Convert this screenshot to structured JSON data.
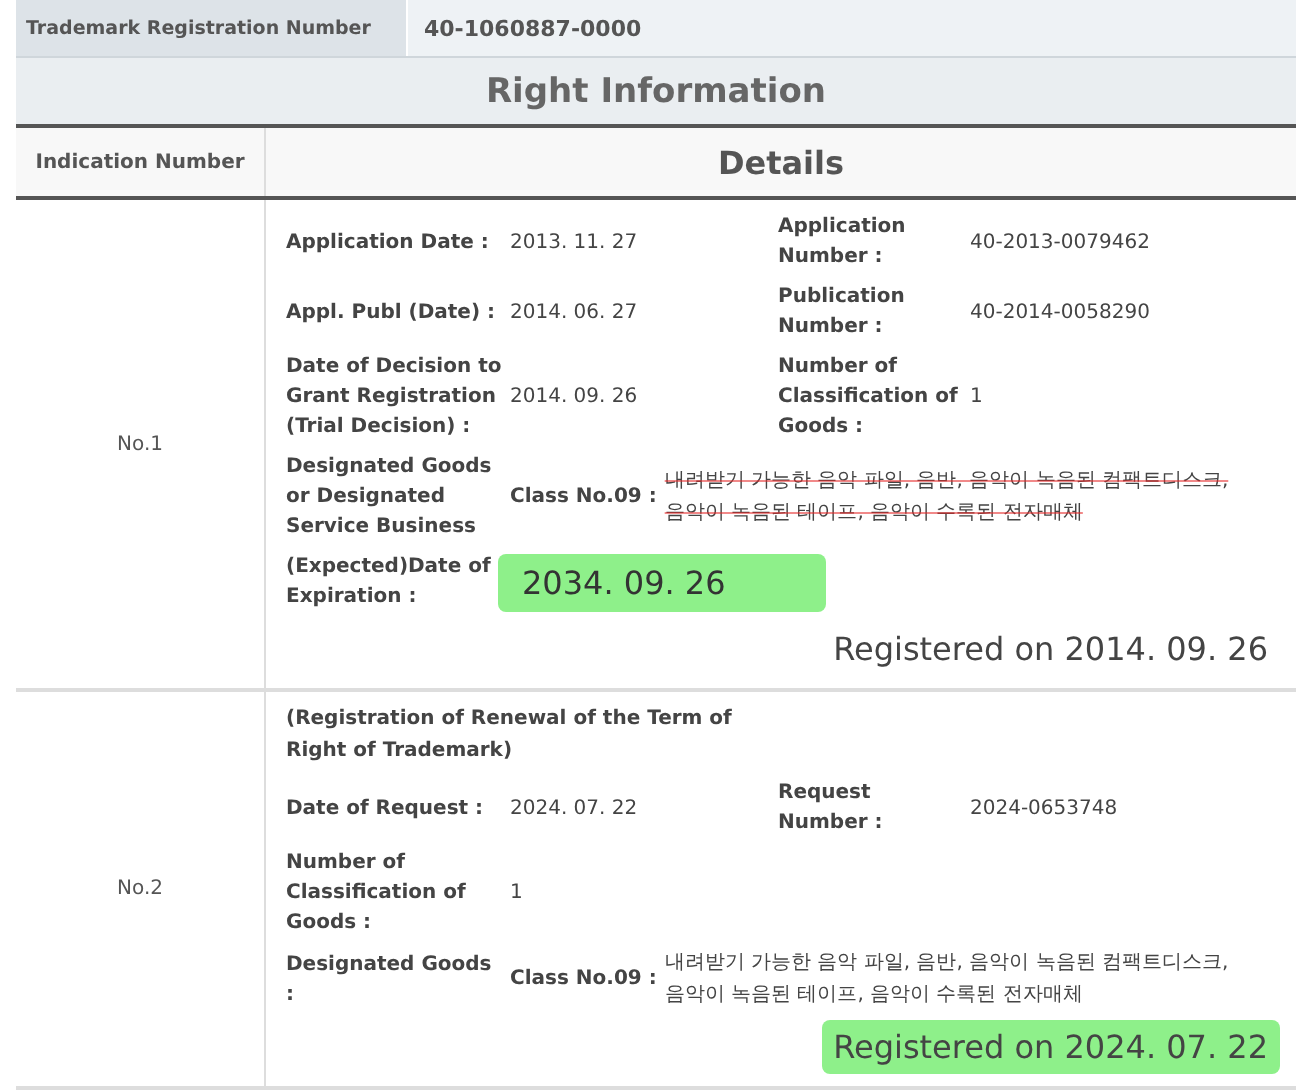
{
  "registration_number": {
    "label": "Trademark Registration Number",
    "value": "40-1060887-0000"
  },
  "section_title": "Right Information",
  "columns": [
    "Indication Number",
    "Details"
  ],
  "records": [
    {
      "number": "No.1",
      "rows": [
        [
          {
            "label": "Application Date :",
            "value": "2013. 11. 27"
          },
          {
            "label": "Application Number :",
            "value": "40-2013-0079462"
          }
        ],
        [
          {
            "label": "Appl. Publ (Date) :",
            "value": "2014. 06. 27"
          },
          {
            "label": "Publication Number :",
            "value": "40-2014-0058290"
          }
        ],
        [
          {
            "label": "Date of Decision to Grant Registration (Trial Decision) :",
            "value": "2014. 09. 26"
          },
          {
            "label": "Number of Classification of Goods :",
            "value": "1"
          }
        ]
      ],
      "designated": {
        "label": "Designated Goods or Designated Service Business",
        "class_label": "Class No.09 :",
        "struck": true,
        "goods_lines": [
          "내려받기 가능한 음악 파일, 음반, 음악이 녹음된 컴팩트디스크,",
          "음악이 녹음된 테이프, 음악이 수록된 전자매체"
        ]
      },
      "expiration": {
        "label": "(Expected)Date of Expiration :",
        "value": "2034. 09. 26",
        "highlighted": true
      },
      "registered": {
        "text": "Registered on 2014. 09. 26",
        "highlighted": false
      }
    },
    {
      "number": "No.2",
      "heading": "(Registration of Renewal of the Term of Right of Trademark)",
      "rows": [
        [
          {
            "label": "Date of Request :",
            "value": "2024. 07. 22"
          },
          {
            "label": "Request Number :",
            "value": "2024-0653748"
          }
        ],
        [
          {
            "label": "Number of Classification of Goods :",
            "value": "1"
          }
        ]
      ],
      "designated": {
        "label": "Designated Goods :",
        "class_label": "Class No.09 :",
        "struck": false,
        "goods_lines": [
          "내려받기 가능한 음악 파일, 음반, 음악이 녹음된 컴팩트디스크,",
          "음악이 녹음된 테이프, 음악이 수록된 전자매체"
        ]
      },
      "registered": {
        "text": "Registered on 2024. 07. 22",
        "highlighted": true
      }
    }
  ]
}
